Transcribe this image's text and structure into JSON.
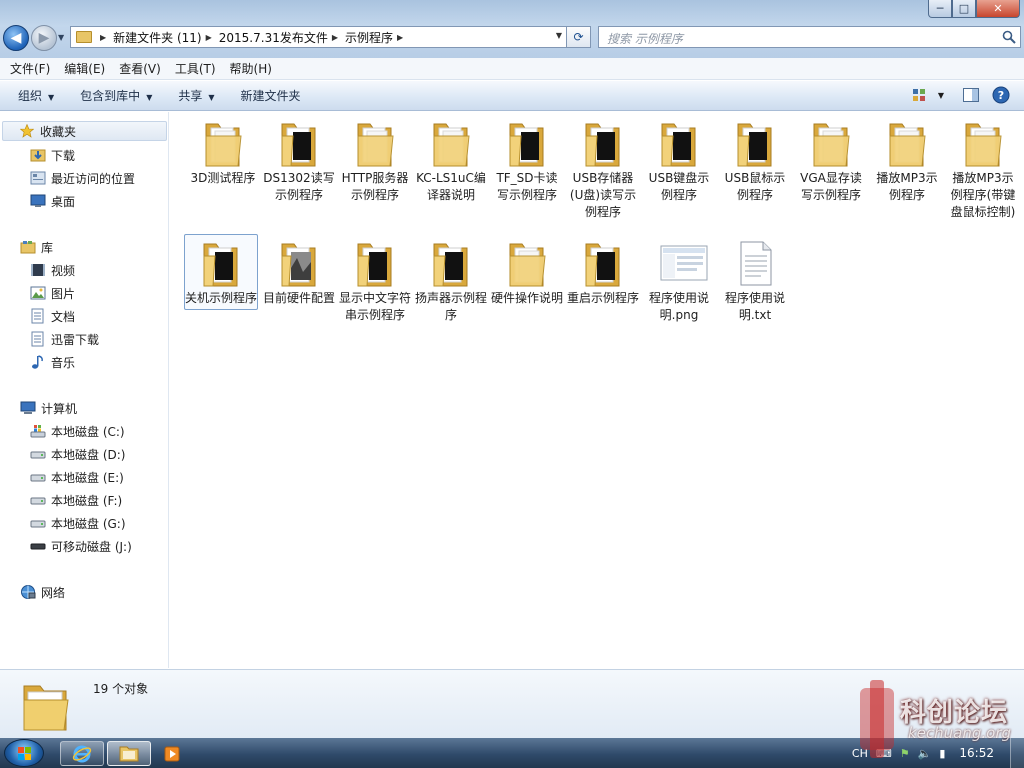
{
  "window": {
    "controls": {
      "minimize": "─",
      "maximize": "□",
      "close": "✕"
    }
  },
  "nav": {
    "back": "◀",
    "forward": "▶",
    "history": "▼"
  },
  "address": {
    "segments": [
      "新建文件夹 (11)",
      "2015.7.31发布文件",
      "示例程序"
    ]
  },
  "search": {
    "placeholder": "搜索 示例程序"
  },
  "menu": [
    "文件(F)",
    "编辑(E)",
    "查看(V)",
    "工具(T)",
    "帮助(H)"
  ],
  "command_bar": {
    "organize": "组织",
    "include_in_library": "包含到库中",
    "share": "共享",
    "new_folder": "新建文件夹"
  },
  "sidebar": {
    "favorites": {
      "label": "收藏夹",
      "items": [
        "下载",
        "最近访问的位置",
        "桌面"
      ]
    },
    "libraries": {
      "label": "库",
      "items": [
        "视频",
        "图片",
        "文档",
        "迅雷下载",
        "音乐"
      ]
    },
    "computer": {
      "label": "计算机",
      "items": [
        "本地磁盘 (C:)",
        "本地磁盘 (D:)",
        "本地磁盘 (E:)",
        "本地磁盘 (F:)",
        "本地磁盘 (G:)",
        "可移动磁盘 (J:)"
      ]
    },
    "network": {
      "label": "网络"
    }
  },
  "files": [
    {
      "name": "3D测试程序",
      "type": "folder-doc"
    },
    {
      "name": "DS1302读写示例程序",
      "type": "folder-dark"
    },
    {
      "name": "HTTP服务器示例程序",
      "type": "folder-doc"
    },
    {
      "name": "KC-LS1uC编译器说明",
      "type": "folder-doc"
    },
    {
      "name": "TF_SD卡读写示例程序",
      "type": "folder-dark"
    },
    {
      "name": "USB存储器(U盘)读写示例程序",
      "type": "folder-dark"
    },
    {
      "name": "USB键盘示例程序",
      "type": "folder-dark"
    },
    {
      "name": "USB鼠标示例程序",
      "type": "folder-dark"
    },
    {
      "name": "VGA显存读写示例程序",
      "type": "folder-doc"
    },
    {
      "name": "播放MP3示例程序",
      "type": "folder-doc"
    },
    {
      "name": "播放MP3示例程序(带键盘鼠标控制)",
      "type": "folder-doc"
    },
    {
      "name": "关机示例程序",
      "type": "folder-dark",
      "selected": true
    },
    {
      "name": "目前硬件配置",
      "type": "folder-photo"
    },
    {
      "name": "显示中文字符串示例程序",
      "type": "folder-dark"
    },
    {
      "name": "扬声器示例程序",
      "type": "folder-dark"
    },
    {
      "name": "硬件操作说明",
      "type": "folder-doc"
    },
    {
      "name": "重启示例程序",
      "type": "folder-dark"
    },
    {
      "name": "程序使用说明.png",
      "type": "image"
    },
    {
      "name": "程序使用说明.txt",
      "type": "text"
    }
  ],
  "details": {
    "count": "19 个对象"
  },
  "taskbar": {
    "language": "CH",
    "clock": "16:52"
  },
  "watermark": {
    "text": "科创论坛",
    "url": "kechuang.org"
  },
  "colors": {
    "folder": "#e8c567",
    "accent": "#1f63b8",
    "selection": "#7da2ce"
  }
}
